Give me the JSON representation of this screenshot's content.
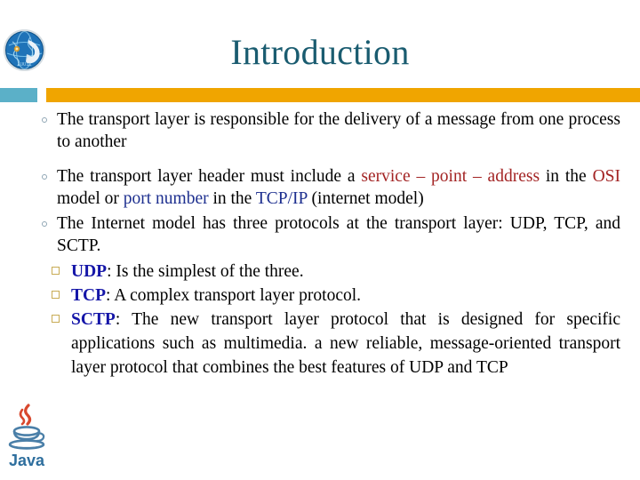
{
  "slide": {
    "title": "Introduction",
    "title_color": "#1a5c70",
    "band": {
      "teal_color": "#5bb0c8",
      "orange_color": "#f0a500"
    },
    "logos": {
      "header_logo": "globe-network-icon",
      "footer_logo": "java-logo",
      "java_wordmark": "Java"
    },
    "colors": {
      "red_highlight": "#a32424",
      "blue_highlight": "#1d2f8f",
      "protocol_key": "#1516a8",
      "body_text": "#000000",
      "circle_marker": "#8fa6b4",
      "square_marker": "#c8ab55"
    },
    "bullets": [
      {
        "level": 1,
        "marker": "circle",
        "segments": [
          {
            "text": "The transport layer is responsible for the delivery of a message from one process to another",
            "style": "plain"
          }
        ]
      },
      {
        "level": 1,
        "marker": "circle",
        "segments": [
          {
            "text": "The transport layer header must include a ",
            "style": "plain"
          },
          {
            "text": "service – point – address",
            "style": "red"
          },
          {
            "text": " in the ",
            "style": "plain"
          },
          {
            "text": "OSI",
            "style": "red"
          },
          {
            "text": " model or ",
            "style": "plain"
          },
          {
            "text": "port number",
            "style": "blue"
          },
          {
            "text": " in the ",
            "style": "plain"
          },
          {
            "text": "TCP/IP",
            "style": "blue"
          },
          {
            "text": " (internet model)",
            "style": "plain"
          }
        ]
      },
      {
        "level": 1,
        "marker": "circle",
        "segments": [
          {
            "text": "The Internet model has three protocols at the transport layer: UDP, TCP, and SCTP.",
            "style": "plain"
          }
        ]
      },
      {
        "level": 2,
        "marker": "square",
        "segments": [
          {
            "text": "UDP",
            "style": "key"
          },
          {
            "text": ": Is the simplest of the three.",
            "style": "plain"
          }
        ]
      },
      {
        "level": 2,
        "marker": "square",
        "segments": [
          {
            "text": "TCP",
            "style": "key"
          },
          {
            "text": ": A complex transport layer protocol.",
            "style": "plain"
          }
        ]
      },
      {
        "level": 2,
        "marker": "square",
        "segments": [
          {
            "text": "SCTP",
            "style": "key"
          },
          {
            "text": ": The new transport layer protocol that is designed for specific applications such as multimedia. a new reliable, message-oriented transport layer protocol that combines the best features of UDP and TCP",
            "style": "plain"
          }
        ]
      }
    ]
  }
}
